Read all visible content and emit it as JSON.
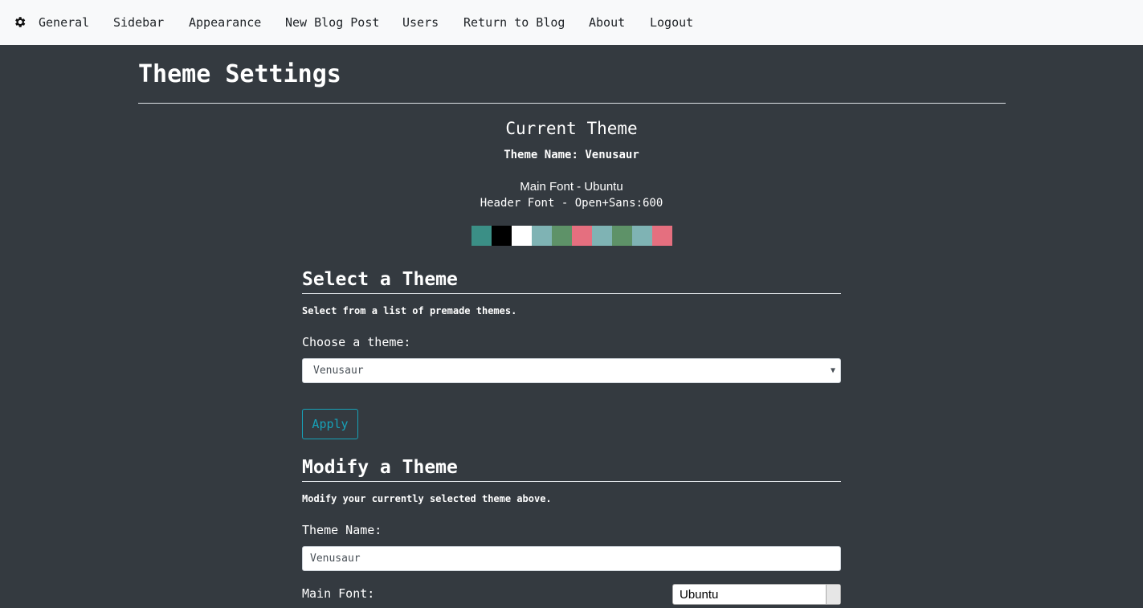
{
  "nav": {
    "gear_icon": "gear-icon",
    "items": [
      "General",
      "Sidebar",
      "Appearance",
      "New Blog Post",
      "Users",
      "Return to Blog",
      "About",
      "Logout"
    ]
  },
  "page_title": "Theme Settings",
  "current_theme": {
    "heading": "Current Theme",
    "name_line": "Theme Name: Venusaur",
    "main_font_line": "Main Font - Ubuntu",
    "header_font_line": "Header Font - Open+Sans:600",
    "swatches": [
      "#3b8f86",
      "#000000",
      "#ffffff",
      "#7fb3b4",
      "#5e9268",
      "#e56f7f",
      "#7fb3b4",
      "#5e9268",
      "#7fb3b4",
      "#e56f7f"
    ]
  },
  "select_theme": {
    "heading": "Select a Theme",
    "description": "Select from a list of premade themes.",
    "label": "Choose a theme:",
    "selected": "Venusaur",
    "apply_label": "Apply"
  },
  "modify_theme": {
    "heading": "Modify a Theme",
    "description": "Modify your currently selected theme above.",
    "name_label": "Theme Name:",
    "name_value": "Venusaur",
    "main_font_label": "Main Font:",
    "main_font_value": "Ubuntu"
  },
  "colors": {
    "accent": "#17a2b8",
    "background": "#343a40",
    "navbar": "#f8f9fa"
  }
}
